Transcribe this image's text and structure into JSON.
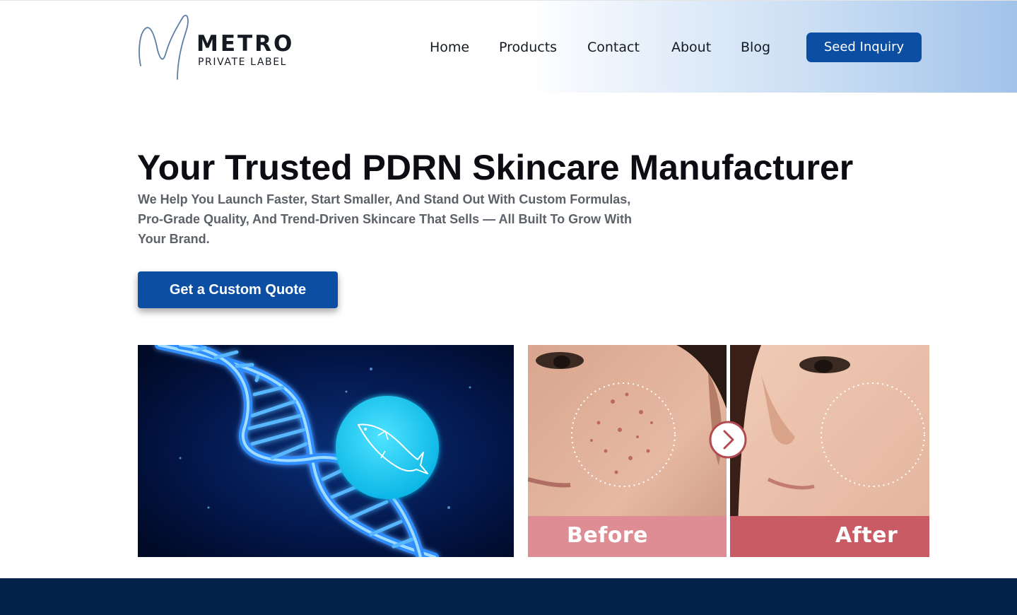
{
  "brand": {
    "name": "METRO",
    "tagline": "PRIVATE LABEL"
  },
  "nav": {
    "items": [
      {
        "label": "Home"
      },
      {
        "label": "Products"
      },
      {
        "label": "Contact"
      },
      {
        "label": "About"
      },
      {
        "label": "Blog"
      }
    ],
    "cta_label": "Seed Inquiry"
  },
  "hero": {
    "title": "Your Trusted PDRN Skincare Manufacturer",
    "subtitle_lines": [
      "We Help You Launch Faster, Start Smaller, And Stand Out With Custom Formulas,",
      "Pro-Grade Quality, And Trend-Driven Skincare That Sells — All Built To Grow With",
      "Your Brand."
    ],
    "cta_label": "Get a Custom Quote"
  },
  "comparison": {
    "before_label": "Before",
    "after_label": "After"
  },
  "colors": {
    "accent": "#0b4ea2",
    "footer": "#03224a",
    "text_dark": "#0b0d12",
    "text_muted": "#5d6168",
    "before_band": "#dd8d93",
    "after_band": "#c85b63"
  },
  "icons": {
    "dna": "dna-helix-image",
    "fish": "fish-icon",
    "compare_arrow": "chevron-right-icon"
  }
}
